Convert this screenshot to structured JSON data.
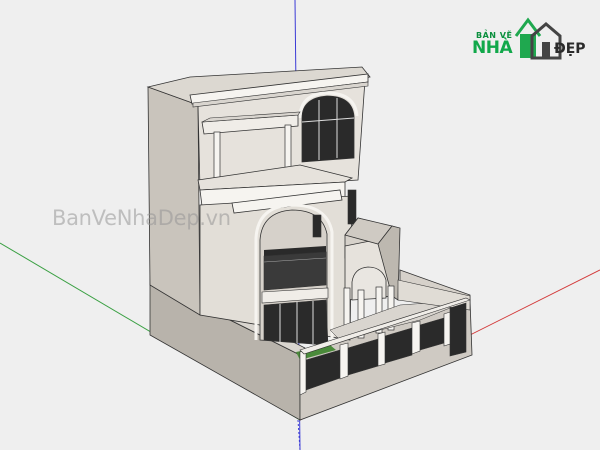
{
  "logo": {
    "small_text": "BẢN VẼ",
    "main_text": "NHÀ",
    "right_text": "ĐẸP"
  },
  "watermark": {
    "text": "BanVeNhaDep.vn"
  },
  "model": {
    "axis_colors": {
      "red": "#d33a3a",
      "green": "#3aa043",
      "blue": "#3b3bd6"
    },
    "wall_colors": {
      "light": "#e6e2dc",
      "mid": "#c9c4bc",
      "dark": "#a9a49c",
      "glass": "#2a2a2a",
      "trim": "#f6f4f0",
      "grass": "#4a8a3a"
    }
  }
}
